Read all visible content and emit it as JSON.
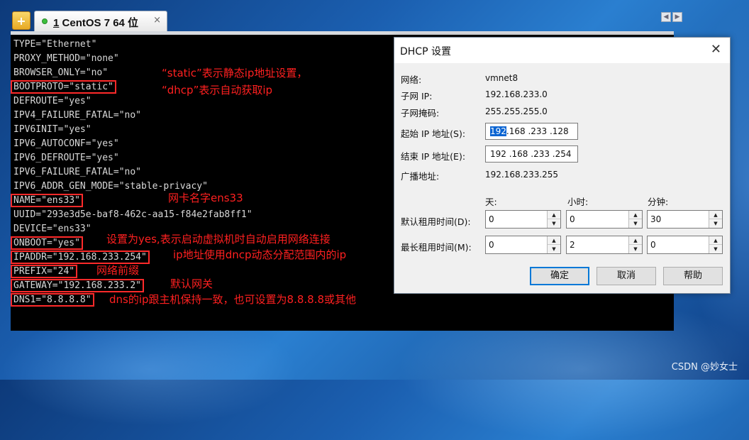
{
  "tabs": {
    "home_icon": "+",
    "active_tab": {
      "number": "1",
      "label": "CentOS 7 64 位",
      "status_color": "#3cbf3c",
      "close": "×"
    },
    "scroll_left": "◀",
    "scroll_right": "▶"
  },
  "terminal": {
    "lines": [
      "TYPE=\"Ethernet\"",
      "PROXY_METHOD=\"none\"",
      "BROWSER_ONLY=\"no\"",
      "BOOTPROTO=\"static\"",
      "DEFROUTE=\"yes\"",
      "IPV4_FAILURE_FATAL=\"no\"",
      "IPV6INIT=\"yes\"",
      "IPV6_AUTOCONF=\"yes\"",
      "IPV6_DEFROUTE=\"yes\"",
      "IPV6_FAILURE_FATAL=\"no\"",
      "IPV6_ADDR_GEN_MODE=\"stable-privacy\"",
      "NAME=\"ens33\"",
      "UUID=\"293e3d5e-baf8-462c-aa15-f84e2fab8ff1\"",
      "DEVICE=\"ens33\"",
      "ONBOOT=\"yes\"",
      "IPADDR=\"192.168.233.254\"",
      "PREFIX=\"24\"",
      "GATEWAY=\"192.168.233.2\"",
      "DNS1=\"8.8.8.8\""
    ],
    "highlight_color": "#ff2a2a"
  },
  "annotations": {
    "bootproto_1": "“static”表示静态ip地址设置，",
    "bootproto_2": "“dhcp”表示自动获取ip",
    "name": "网卡名字ens33",
    "onboot": "设置为yes,表示启动虚拟机时自动启用网络连接",
    "ipaddr": "ip地址使用dncp动态分配范围内的ip",
    "prefix": "网络前缀",
    "gateway": "默认网关",
    "dns": "dns的ip跟主机保持一致，也可设置为8.8.8.8或其他",
    "color": "#ff2020"
  },
  "dialog": {
    "title": "DHCP 设置",
    "close": "✕",
    "network_label": "网络:",
    "network_value": "vmnet8",
    "subnet_label": "子网 IP:",
    "subnet_value": "192.168.233.0",
    "mask_label": "子网掩码:",
    "mask_value": "255.255.255.0",
    "start_label": "起始 IP 地址(S):",
    "start_sel": "192",
    "start_rest": ".168 .233 .128",
    "end_label": "结束 IP 地址(E):",
    "end_value": "192 .168 .233 .254",
    "broadcast_label": "广播地址:",
    "broadcast_value": "192.168.233.255",
    "col_days": "天:",
    "col_hours": "小时:",
    "col_minutes": "分钟:",
    "default_lease_label": "默认租用时间(D):",
    "default_lease": {
      "days": "0",
      "hours": "0",
      "minutes": "30"
    },
    "max_lease_label": "最长租用时间(M):",
    "max_lease": {
      "days": "0",
      "hours": "2",
      "minutes": "0"
    },
    "ok": "确定",
    "cancel": "取消",
    "help": "帮助"
  },
  "watermark": "CSDN @妙女士"
}
